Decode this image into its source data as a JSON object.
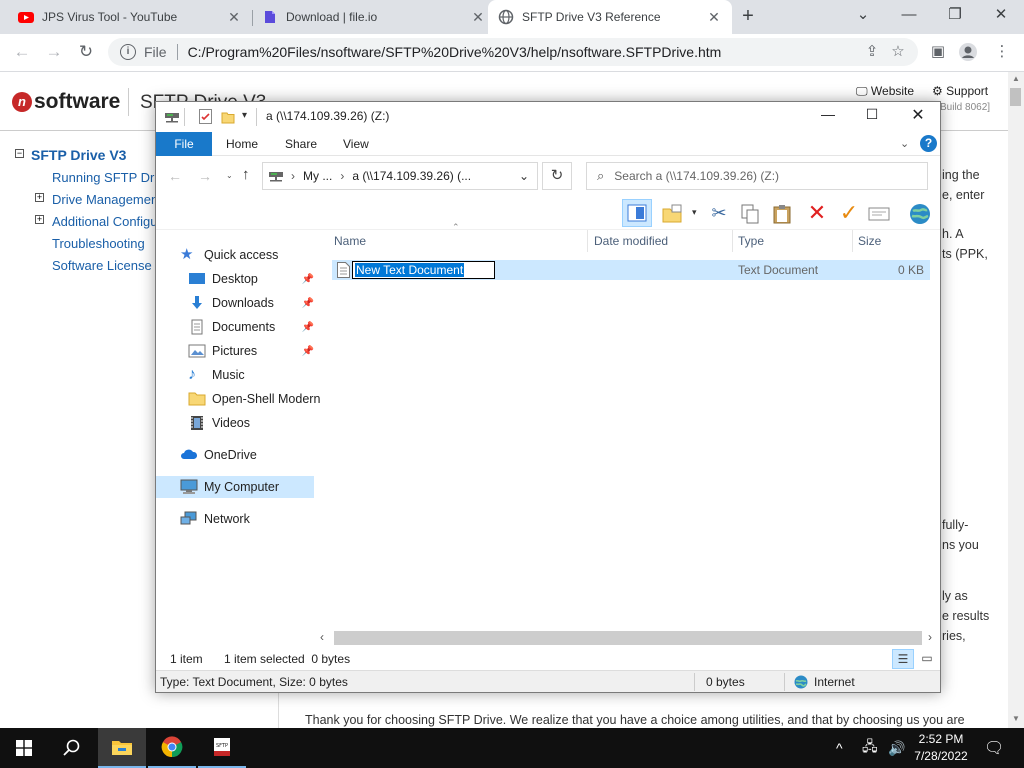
{
  "browser": {
    "tabs": [
      {
        "title": "JPS Virus Tool - YouTube",
        "favicon": "youtube-icon"
      },
      {
        "title": "Download | file.io",
        "favicon": "fileio-icon"
      },
      {
        "title": "SFTP Drive V3 Reference",
        "favicon": "globe-icon",
        "active": true
      }
    ],
    "omnibox": {
      "scheme_label": "File",
      "url": "C:/Program%20Files/nsoftware/SFTP%20Drive%20V3/help/nsoftware.SFTPDrive.htm"
    }
  },
  "webpage": {
    "logo_text": "software",
    "logo_mark": "n",
    "product_title": "SFTP Drive V3",
    "header_links": {
      "website": "Website",
      "support": "Support"
    },
    "build_text": "Build 8062]",
    "tree": {
      "root": "SFTP Drive V3",
      "items": [
        "Running SFTP Drive",
        "Drive Management",
        "Additional Configuration",
        "Troubleshooting",
        "Software License"
      ]
    },
    "right_fragments": [
      "ing the",
      "e, enter",
      "h. A",
      "ts (PPK,",
      "fully-",
      "ns you",
      "ly as",
      "e results",
      "ries,"
    ],
    "bottom_line": "Thank you for choosing SFTP Drive. We realize that you have a choice among utilities, and that by choosing us you are"
  },
  "explorer": {
    "title": "a (\\\\174.109.39.26) (Z:)",
    "ribbon_tabs": {
      "file": "File",
      "home": "Home",
      "share": "Share",
      "view": "View"
    },
    "address": {
      "crumb1": "My ...",
      "crumb2": "a (\\\\174.109.39.26) (..."
    },
    "search_placeholder": "Search a (\\\\174.109.39.26) (Z:)",
    "nav": {
      "quick_access": "Quick access",
      "desktop": "Desktop",
      "downloads": "Downloads",
      "documents": "Documents",
      "pictures": "Pictures",
      "music": "Music",
      "openshell": "Open-Shell Modern",
      "videos": "Videos",
      "onedrive": "OneDrive",
      "mycomputer": "My Computer",
      "network": "Network"
    },
    "columns": {
      "name": "Name",
      "date": "Date modified",
      "type": "Type",
      "size": "Size"
    },
    "file": {
      "name": "New Text Document",
      "type": "Text Document",
      "size": "0 KB"
    },
    "status": {
      "items": "1 item",
      "selected": "1 item selected  0 bytes"
    },
    "details": {
      "info": "Type: Text Document, Size: 0 bytes",
      "bytes": "0 bytes",
      "zone": "Internet"
    }
  },
  "taskbar": {
    "time": "2:52 PM",
    "date": "7/28/2022"
  },
  "colors": {
    "accent": "#1979ca",
    "selection": "#cce8ff",
    "taskbar": "#101010"
  }
}
